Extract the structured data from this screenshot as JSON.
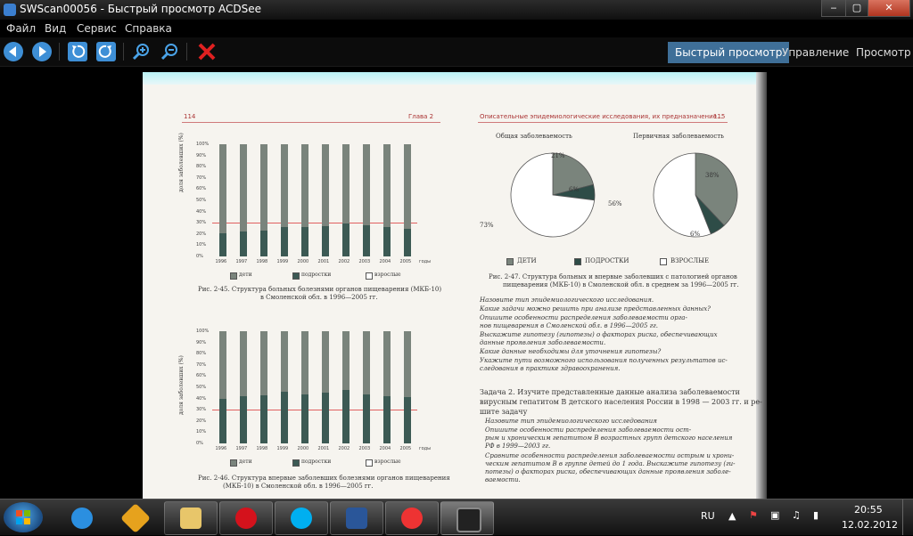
{
  "window": {
    "title": "SWScan00056 - Быстрый просмотр ACDSee",
    "minimize": "‒",
    "maximize": "▢",
    "close": "✕"
  },
  "menu": [
    "Файл",
    "Вид",
    "Сервис",
    "Справка"
  ],
  "toolbar": {
    "icons": [
      "back-icon",
      "forward-icon",
      "rotate-left-icon",
      "rotate-right-icon",
      "zoom-in-icon",
      "zoom-out-icon",
      "delete-icon"
    ]
  },
  "modes": [
    "Быстрый просмотр",
    "Управление",
    "Просмотр"
  ],
  "document": {
    "left_page_number": "114",
    "left_header": "Глава 2",
    "right_header": "Описательные эпидемиологические исследования, их предназначение...",
    "right_page_number": "115",
    "fig45_caption_1": "Рис. 2-45. Структура больных болезнями органов пищеварения (МКБ-10)",
    "fig45_caption_2": "в Смоленской обл. в 1996—2005 гг.",
    "fig46_caption_1": "Рис. 2-46. Структура впервые заболевших болезнями органов пищеварения",
    "fig46_caption_2": "(МКБ-10) в Смоленской обл. в 1996—2005 гг.",
    "fig47_caption_1": "Рис. 2-47. Структура больных и впервые заболевших с патологией органов",
    "fig47_caption_2": "пищеварения (МКБ-10) в Смоленской обл. в среднем за 1996—2005 гг.",
    "pie1_title": "Общая заболеваемость",
    "pie2_title": "Первичная заболеваемость",
    "pie1_labels": [
      "21%",
      "6%",
      "73%"
    ],
    "pie2_labels": [
      "38%",
      "56%",
      "6%"
    ],
    "legend": [
      "дети",
      "подростки",
      "взрослые"
    ],
    "pie_legend": [
      "ДЕТИ",
      "ПОДРОСТКИ",
      "ВЗРОСЛЫЕ"
    ],
    "ylabel": "доля заболевших (%)",
    "year_suffix": "годы",
    "bullets1": [
      "Назовите тип эпидемиологического исследования.",
      "Какие задачи можно решить при анализе представленных данных?",
      "Опишите особенности распределения заболеваемости орга-",
      "нов пищеварения в Смоленской обл. в 1996—2005 гг.",
      "Выскажите гипотезу (гипотезы) о факторах риска, обеспечивающих",
      "данные проявления заболеваемости.",
      "Какие данные необходимы для уточнения гипотезы?",
      "Укажите пути возможного использования полученных результатов ис-",
      "следования в практике здравоохранения."
    ],
    "task2": [
      "Задача 2. Изучите представленные данные анализа заболеваемости",
      "вирусным гепатитом В детского населения России в 1998 — 2003 гг. и ре-",
      "шите задачу",
      "Назовите тип эпидемиологического исследования",
      "Опишите особенности распределения заболеваемости ост-",
      "рым и хроническим гепатитом В возрастных групп детского населения",
      "РФ в 1999—2003 гг.",
      "Сравните особенности распределения заболеваемости острым и хрони-",
      "ческим гепатитом В в группе детей до 1 года. Выскажите гипотезу (ги-",
      "потезы) о факторах риска, обеспечивающих данные проявления заболе-",
      "ваемости."
    ]
  },
  "chart_data": [
    {
      "type": "bar",
      "title": "",
      "categories": [
        "1996",
        "1997",
        "1998",
        "1999",
        "2000",
        "2001",
        "2002",
        "2003",
        "2004",
        "2005"
      ],
      "series": [
        {
          "name": "подростки",
          "values": [
            21,
            22,
            23,
            26,
            26,
            27,
            29,
            28,
            26,
            25
          ]
        },
        {
          "name": "взрослые",
          "values": [
            79,
            78,
            77,
            74,
            74,
            73,
            71,
            72,
            74,
            75
          ]
        }
      ],
      "yticks": [
        "0%",
        "10%",
        "20%",
        "30%",
        "40%",
        "50%",
        "60%",
        "70%",
        "80%",
        "90%",
        "100%"
      ],
      "ylabel": "доля заболевших (%)",
      "ylim": [
        0,
        100
      ]
    },
    {
      "type": "bar",
      "title": "",
      "categories": [
        "1996",
        "1997",
        "1998",
        "1999",
        "2000",
        "2001",
        "2002",
        "2003",
        "2004",
        "2005"
      ],
      "series": [
        {
          "name": "подростки",
          "values": [
            40,
            42,
            43,
            46,
            44,
            45,
            48,
            44,
            42,
            41
          ]
        },
        {
          "name": "взрослые",
          "values": [
            60,
            58,
            57,
            54,
            56,
            55,
            52,
            56,
            58,
            59
          ]
        }
      ],
      "yticks": [
        "0%",
        "10%",
        "20%",
        "30%",
        "40%",
        "50%",
        "60%",
        "70%",
        "80%",
        "90%",
        "100%"
      ],
      "ylabel": "доля заболевших (%)",
      "ylim": [
        0,
        100
      ]
    },
    {
      "type": "pie",
      "title": "Общая заболеваемость",
      "labels": [
        "ДЕТИ",
        "ПОДРОСТКИ",
        "ВЗРОСЛЫЕ"
      ],
      "values": [
        21,
        6,
        73
      ]
    },
    {
      "type": "pie",
      "title": "Первичная заболеваемость",
      "labels": [
        "ДЕТИ",
        "ПОДРОСТКИ",
        "ВЗРОСЛЫЕ"
      ],
      "values": [
        38,
        6,
        56
      ]
    }
  ],
  "taskbar": {
    "apps": [
      "ie-icon",
      "winamp-icon",
      "explorer-icon",
      "opera-icon",
      "skype-icon",
      "word-icon",
      "finereader-icon",
      "acdsee-icon"
    ],
    "lang": "RU",
    "time": "20:55",
    "date": "12.02.2012"
  }
}
